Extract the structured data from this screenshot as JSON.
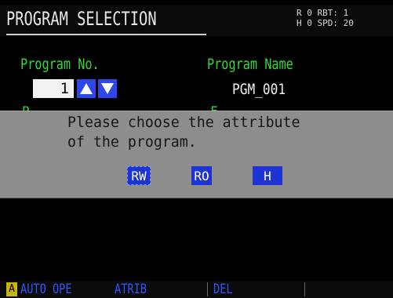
{
  "screen": {
    "title": "PROGRAM SELECTION",
    "status": {
      "row1": "R 0  RBT: 1",
      "row2": "H 0  SPD: 20"
    }
  },
  "program": {
    "number_label": "Program No.",
    "number_value": "1",
    "name_label": "Program Name",
    "name_value": "PGM_001",
    "partial_label_left": "P   ",
    "partial_label_right": "F"
  },
  "dialog": {
    "line1": "Please choose the attribute",
    "line2": "of the program.",
    "buttons": {
      "rw": "RW",
      "ro": "RO",
      "h": "H"
    }
  },
  "function_bar": {
    "indicator": "A",
    "keys": {
      "auto_open": "AUTO OPE",
      "atrib": "ATRIB",
      "del": "DEL"
    }
  },
  "colors": {
    "label_green": "#2fdc3a",
    "button_blue": "#1e33d2",
    "dialog_gray": "#8d8d8d",
    "fn_text_blue": "#2c56ff"
  }
}
